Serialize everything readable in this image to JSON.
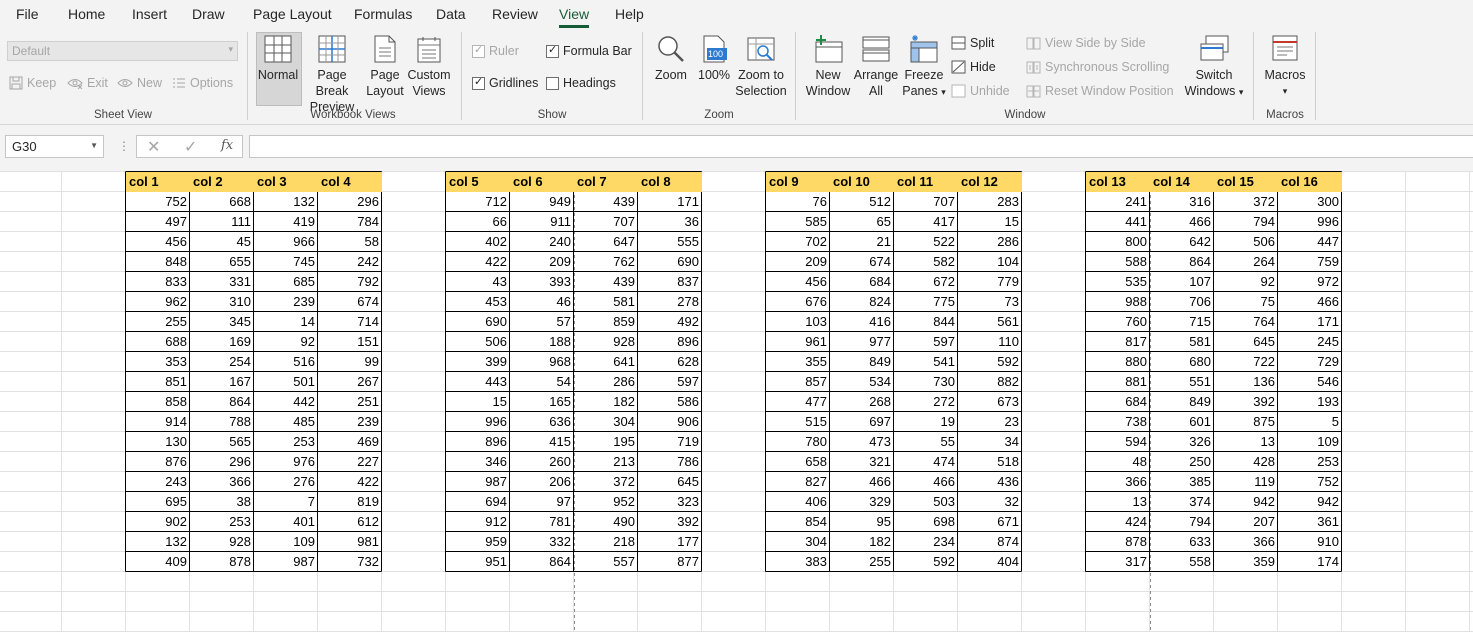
{
  "menu": {
    "tabs": [
      "File",
      "Home",
      "Insert",
      "Draw",
      "Page Layout",
      "Formulas",
      "Data",
      "Review",
      "View",
      "Help"
    ],
    "active": "View"
  },
  "ribbon": {
    "sheet_view": {
      "select_value": "Default",
      "keep": "Keep",
      "exit": "Exit",
      "new": "New",
      "options": "Options",
      "label": "Sheet View"
    },
    "workbook_views": {
      "normal": "Normal",
      "page_break_1": "Page Break",
      "page_break_2": "Preview",
      "page_layout_1": "Page",
      "page_layout_2": "Layout",
      "custom_1": "Custom",
      "custom_2": "Views",
      "label": "Workbook Views"
    },
    "show": {
      "ruler": "Ruler",
      "formula_bar": "Formula Bar",
      "gridlines": "Gridlines",
      "headings": "Headings",
      "ruler_checked": true,
      "formula_bar_checked": true,
      "gridlines_checked": true,
      "headings_checked": false,
      "label": "Show"
    },
    "zoom": {
      "zoom": "Zoom",
      "hundred": "100%",
      "hundred_icon_text": "100",
      "zoom_sel_1": "Zoom to",
      "zoom_sel_2": "Selection",
      "label": "Zoom"
    },
    "window": {
      "new_1": "New",
      "new_2": "Window",
      "arrange_1": "Arrange",
      "arrange_2": "All",
      "freeze_1": "Freeze",
      "freeze_2": "Panes",
      "split": "Split",
      "hide": "Hide",
      "unhide": "Unhide",
      "side_by_side": "View Side by Side",
      "sync_scroll": "Synchronous Scrolling",
      "reset_pos": "Reset Window Position",
      "switch_1": "Switch",
      "switch_2": "Windows",
      "label": "Window"
    },
    "macros": {
      "btn": "Macros",
      "label": "Macros"
    }
  },
  "formula_bar": {
    "name_box": "G30",
    "fx": "fx",
    "formula": ""
  },
  "sheet": {
    "blocks": [
      {
        "headers": [
          "col 1",
          "col 2",
          "col 3",
          "col 4"
        ],
        "rows": [
          [
            752,
            668,
            132,
            296
          ],
          [
            497,
            111,
            419,
            784
          ],
          [
            456,
            45,
            966,
            58
          ],
          [
            848,
            655,
            745,
            242
          ],
          [
            833,
            331,
            685,
            792
          ],
          [
            962,
            310,
            239,
            674
          ],
          [
            255,
            345,
            14,
            714
          ],
          [
            688,
            169,
            92,
            151
          ],
          [
            353,
            254,
            516,
            99
          ],
          [
            851,
            167,
            501,
            267
          ],
          [
            858,
            864,
            442,
            251
          ],
          [
            914,
            788,
            485,
            239
          ],
          [
            130,
            565,
            253,
            469
          ],
          [
            876,
            296,
            976,
            227
          ],
          [
            243,
            366,
            276,
            422
          ],
          [
            695,
            38,
            7,
            819
          ],
          [
            902,
            253,
            401,
            612
          ],
          [
            132,
            928,
            109,
            981
          ],
          [
            409,
            878,
            987,
            732
          ]
        ]
      },
      {
        "headers": [
          "col 5",
          "col 6",
          "col 7",
          "col 8"
        ],
        "rows": [
          [
            712,
            949,
            439,
            171
          ],
          [
            66,
            911,
            707,
            36
          ],
          [
            402,
            240,
            647,
            555
          ],
          [
            422,
            209,
            762,
            690
          ],
          [
            43,
            393,
            439,
            837
          ],
          [
            453,
            46,
            581,
            278
          ],
          [
            690,
            57,
            859,
            492
          ],
          [
            506,
            188,
            928,
            896
          ],
          [
            399,
            968,
            641,
            628
          ],
          [
            443,
            54,
            286,
            597
          ],
          [
            15,
            165,
            182,
            586
          ],
          [
            996,
            636,
            304,
            906
          ],
          [
            896,
            415,
            195,
            719
          ],
          [
            346,
            260,
            213,
            786
          ],
          [
            987,
            206,
            372,
            645
          ],
          [
            694,
            97,
            952,
            323
          ],
          [
            912,
            781,
            490,
            392
          ],
          [
            959,
            332,
            218,
            177
          ],
          [
            951,
            864,
            557,
            877
          ]
        ]
      },
      {
        "headers": [
          "col 9",
          "col 10",
          "col 11",
          "col 12"
        ],
        "rows": [
          [
            76,
            512,
            707,
            283
          ],
          [
            585,
            65,
            417,
            15
          ],
          [
            702,
            21,
            522,
            286
          ],
          [
            209,
            674,
            582,
            104
          ],
          [
            456,
            684,
            672,
            779
          ],
          [
            676,
            824,
            775,
            73
          ],
          [
            103,
            416,
            844,
            561
          ],
          [
            961,
            977,
            597,
            110
          ],
          [
            355,
            849,
            541,
            592
          ],
          [
            857,
            534,
            730,
            882
          ],
          [
            477,
            268,
            272,
            673
          ],
          [
            515,
            697,
            19,
            23
          ],
          [
            780,
            473,
            55,
            34
          ],
          [
            658,
            321,
            474,
            518
          ],
          [
            827,
            466,
            466,
            436
          ],
          [
            406,
            329,
            503,
            32
          ],
          [
            854,
            95,
            698,
            671
          ],
          [
            304,
            182,
            234,
            874
          ],
          [
            383,
            255,
            592,
            404
          ]
        ]
      },
      {
        "headers": [
          "col 13",
          "col 14",
          "col 15",
          "col 16"
        ],
        "rows": [
          [
            241,
            316,
            372,
            300
          ],
          [
            441,
            466,
            794,
            996
          ],
          [
            800,
            642,
            506,
            447
          ],
          [
            588,
            864,
            264,
            759
          ],
          [
            535,
            107,
            92,
            972
          ],
          [
            988,
            706,
            75,
            466
          ],
          [
            760,
            715,
            764,
            171
          ],
          [
            817,
            581,
            645,
            245
          ],
          [
            880,
            680,
            722,
            729
          ],
          [
            881,
            551,
            136,
            546
          ],
          [
            684,
            849,
            392,
            193
          ],
          [
            738,
            601,
            875,
            5
          ],
          [
            594,
            326,
            13,
            109
          ],
          [
            48,
            250,
            428,
            253
          ],
          [
            366,
            385,
            119,
            752
          ],
          [
            13,
            374,
            942,
            942
          ],
          [
            424,
            794,
            207,
            361
          ],
          [
            878,
            633,
            366,
            910
          ],
          [
            317,
            558,
            359,
            174
          ]
        ]
      }
    ]
  }
}
